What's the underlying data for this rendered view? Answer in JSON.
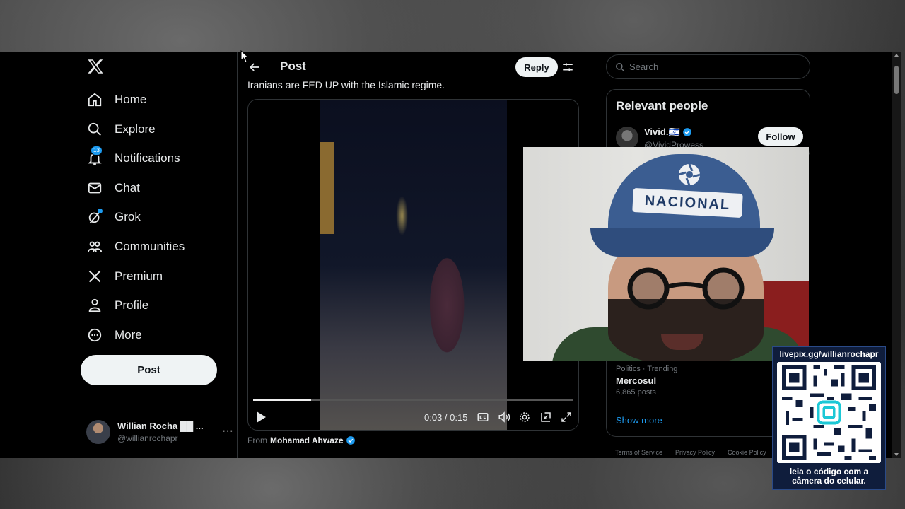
{
  "nav": {
    "items": [
      {
        "label": "Home",
        "icon": "home-icon"
      },
      {
        "label": "Explore",
        "icon": "search-icon"
      },
      {
        "label": "Notifications",
        "icon": "bell-icon",
        "badge": "13"
      },
      {
        "label": "Chat",
        "icon": "mail-icon"
      },
      {
        "label": "Grok",
        "icon": "grok-icon"
      },
      {
        "label": "Communities",
        "icon": "people-icon"
      },
      {
        "label": "Premium",
        "icon": "x-icon"
      },
      {
        "label": "Profile",
        "icon": "person-icon"
      },
      {
        "label": "More",
        "icon": "more-circle-icon"
      }
    ],
    "post_button": "Post"
  },
  "account": {
    "name": "Willian Rocha ██ ...",
    "handle": "@willianrochapr",
    "more": "···"
  },
  "header": {
    "title": "Post",
    "reply_label": "Reply"
  },
  "post": {
    "text": "Iranians are FED UP with the Islamic regime.",
    "from_prefix": "From",
    "from_name": "Mohamad Ahwaze"
  },
  "video": {
    "time": "0:03 / 0:15",
    "progress": 0.18
  },
  "search": {
    "placeholder": "Search"
  },
  "relevant": {
    "title": "Relevant people",
    "person_name": "Vivid.🇮🇱",
    "person_handle": "@VividProwess",
    "follow_label": "Follow"
  },
  "trend": {
    "category": "Politics · Trending",
    "name": "Mercosul",
    "count": "6,865 posts",
    "show_more": "Show more"
  },
  "footer": {
    "links": [
      "Terms of Service",
      "Privacy Policy",
      "Cookie Policy"
    ]
  },
  "webcam": {
    "cap_text": "NACIONAL"
  },
  "donation": {
    "url": "livepix.gg/willianrochapr",
    "caption_line1": "leia o código com a",
    "caption_line2": "câmera do celular."
  },
  "colors": {
    "accent": "#1d9bf0",
    "background": "#000000",
    "border": "#2f3336",
    "text_secondary": "#71767b"
  }
}
